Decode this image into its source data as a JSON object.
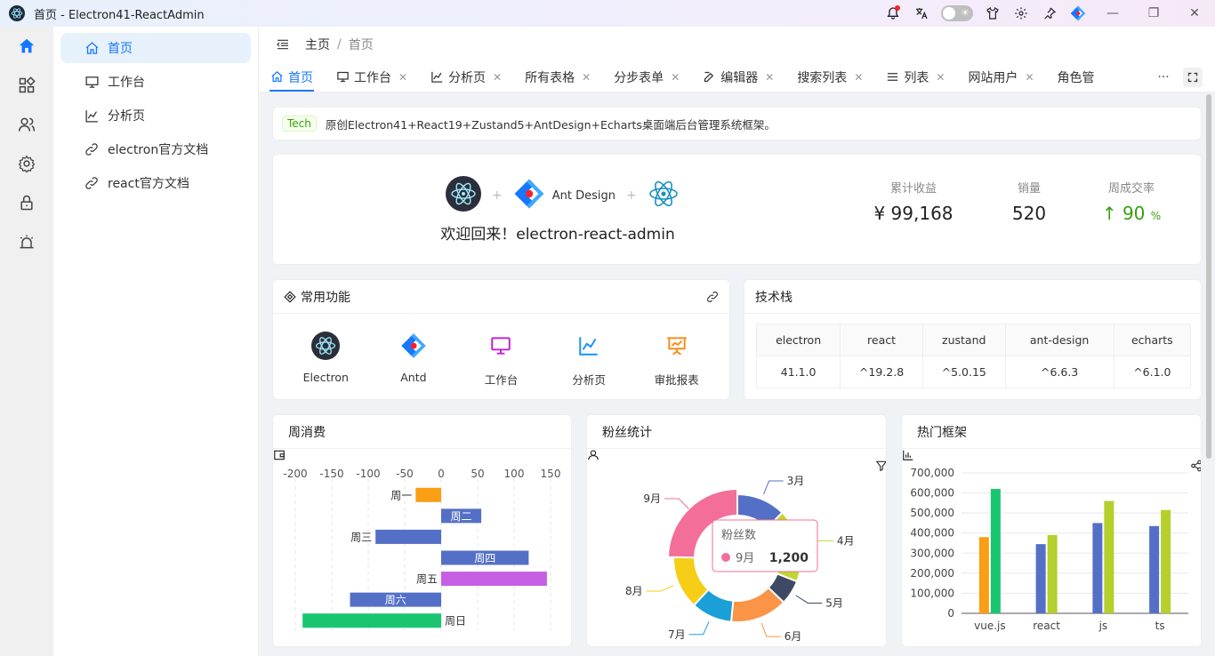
{
  "window": {
    "title": "首页 - Electron41-ReactAdmin"
  },
  "colors": {
    "primary": "#1677ff",
    "success": "#389e0d"
  },
  "rail": [
    "home-icon",
    "apps-icon",
    "users-icon",
    "gear-icon",
    "lock-icon",
    "alarm-icon"
  ],
  "menu": {
    "items": [
      {
        "label": "首页",
        "icon": "home-icon"
      },
      {
        "label": "工作台",
        "icon": "monitor-icon"
      },
      {
        "label": "分析页",
        "icon": "line-chart-icon"
      },
      {
        "label": "electron官方文档",
        "icon": "link-icon"
      },
      {
        "label": "react官方文档",
        "icon": "link-icon"
      }
    ]
  },
  "breadcrumb": {
    "root": "主页",
    "sep": "/",
    "current": "首页"
  },
  "tabs": [
    {
      "label": "首页",
      "icon": "home-icon"
    },
    {
      "label": "工作台",
      "icon": "monitor-icon"
    },
    {
      "label": "分析页",
      "icon": "line-chart-icon"
    },
    {
      "label": "所有表格"
    },
    {
      "label": "分步表单"
    },
    {
      "label": "编辑器",
      "icon": "edit-icon"
    },
    {
      "label": "搜索列表"
    },
    {
      "label": "列表",
      "icon": "list-icon"
    },
    {
      "label": "网站用户"
    },
    {
      "label": "角色管"
    }
  ],
  "tabs_more": "···",
  "notice": {
    "tag": "Tech",
    "text": "原创Electron41+React19+Zustand5+AntDesign+Echarts桌面端后台管理系统框架。"
  },
  "welcome": {
    "plus": "+",
    "ant_text": "Ant Design",
    "greeting": "欢迎回来！electron-react-admin",
    "stats": [
      {
        "label": "累计收益",
        "value": "¥ 99,168"
      },
      {
        "label": "销量",
        "value": "520"
      },
      {
        "label": "周成交率",
        "value": "90",
        "unit": "%"
      }
    ]
  },
  "functions": {
    "title": "常用功能",
    "items": [
      {
        "label": "Electron",
        "icon": "electron-icon"
      },
      {
        "label": "Antd",
        "icon": "antd-icon"
      },
      {
        "label": "工作台",
        "icon": "monitor-icon",
        "color": "#c41dd1"
      },
      {
        "label": "分析页",
        "icon": "line-chart-icon",
        "color": "#1890ff"
      },
      {
        "label": "审批报表",
        "icon": "presentation-icon",
        "color": "#fa8c16"
      }
    ]
  },
  "stack": {
    "title": "技术栈",
    "headers": [
      "electron",
      "react",
      "zustand",
      "ant-design",
      "echarts"
    ],
    "values": [
      "41.1.0",
      "^19.2.8",
      "^5.0.15",
      "^6.6.3",
      "^6.1.0"
    ]
  },
  "chart_data": [
    {
      "type": "bar",
      "title": "周消费",
      "orientation": "horizontal",
      "categories": [
        "周一",
        "周二",
        "周三",
        "周四",
        "周五",
        "周六",
        "周日"
      ],
      "values": [
        -35,
        55,
        -90,
        120,
        145,
        -125,
        -190
      ],
      "colors": [
        "#fa9e14",
        "#5470c6",
        "#5470c6",
        "#5470c6",
        "#c65ee3",
        "#5470c6",
        "#19c66f"
      ],
      "xlim": [
        -200,
        150
      ],
      "xticks": [
        -200,
        -150,
        -100,
        -50,
        0,
        50,
        100,
        150
      ]
    },
    {
      "type": "pie",
      "title": "粉丝统计",
      "labels": [
        "3月",
        "4月",
        "5月",
        "6月",
        "7月",
        "8月",
        "9月"
      ],
      "values": [
        600,
        900,
        300,
        700,
        500,
        650,
        1200
      ],
      "colors": [
        "#5470c6",
        "#c0d62e",
        "#3c4a63",
        "#fa9446",
        "#1a9fd6",
        "#f6cd17",
        "#f36e98"
      ],
      "tooltip": {
        "title": "粉丝数",
        "label": "9月",
        "value": "1,200"
      }
    },
    {
      "type": "bar",
      "title": "热门框架",
      "categories": [
        "vue.js",
        "react",
        "js",
        "ts"
      ],
      "series": [
        {
          "values": [
            380000,
            null,
            null,
            null
          ],
          "color": "#fa9e14"
        },
        {
          "values": [
            620000,
            345000,
            450000,
            435000
          ],
          "color": "#5470c6"
        },
        {
          "values": [
            null,
            390000,
            560000,
            515000
          ],
          "color": "#b5cf2c"
        }
      ],
      "bar_colors": [
        [
          "#fa9e14",
          "#19c66f"
        ],
        [
          "#5470c6",
          "#b5cf2c"
        ],
        [
          "#5470c6",
          "#b5cf2c"
        ],
        [
          "#5470c6",
          "#b5cf2c"
        ]
      ],
      "bar_values": [
        [
          380000,
          620000
        ],
        [
          345000,
          390000
        ],
        [
          450000,
          560000
        ],
        [
          435000,
          515000
        ]
      ],
      "ylim": [
        0,
        700000
      ],
      "yticks": [
        "0",
        "100,000",
        "200,000",
        "300,000",
        "400,000",
        "500,000",
        "600,000",
        "700,000"
      ]
    }
  ]
}
